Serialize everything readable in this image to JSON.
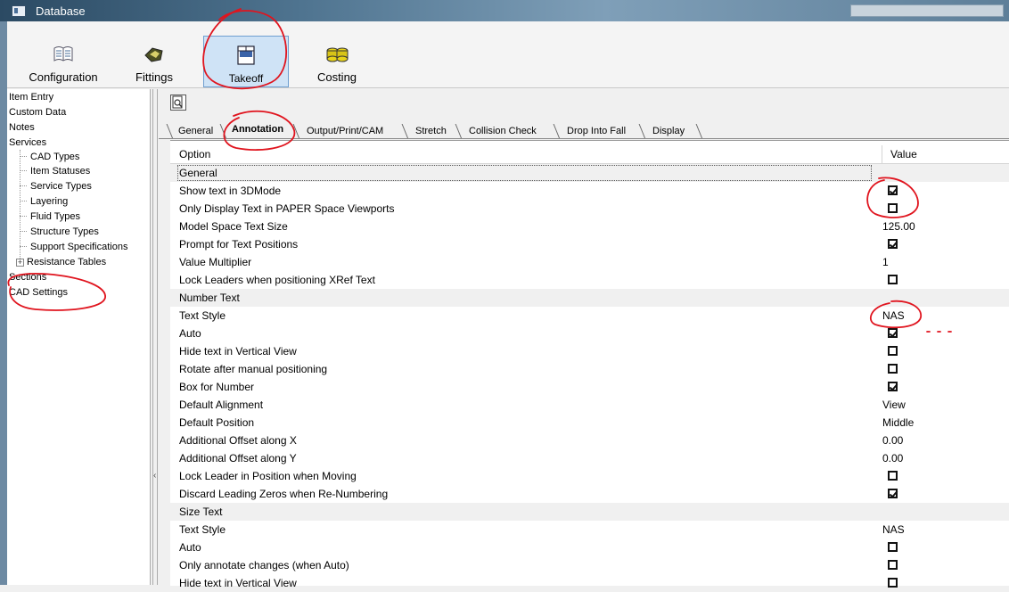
{
  "window": {
    "title": "Database"
  },
  "ribbon": {
    "buttons": [
      {
        "label": "Configuration"
      },
      {
        "label": "Fittings"
      },
      {
        "label": "Takeoff"
      },
      {
        "label": "Costing"
      }
    ]
  },
  "sidebar": {
    "items": [
      {
        "label": "Item Entry"
      },
      {
        "label": "Custom Data"
      },
      {
        "label": "Notes"
      },
      {
        "label": "Services"
      },
      {
        "label": "CAD Types"
      },
      {
        "label": "Item Statuses"
      },
      {
        "label": "Service Types"
      },
      {
        "label": "Layering"
      },
      {
        "label": "Fluid Types"
      },
      {
        "label": "Structure Types"
      },
      {
        "label": "Support Specifications"
      },
      {
        "label": "Resistance Tables"
      },
      {
        "label": "Sections"
      },
      {
        "label": "CAD Settings"
      }
    ]
  },
  "tabs": [
    {
      "label": "General"
    },
    {
      "label": "Annotation"
    },
    {
      "label": "Output/Print/CAM"
    },
    {
      "label": "Stretch"
    },
    {
      "label": "Collision Check"
    },
    {
      "label": "Drop Into Fall"
    },
    {
      "label": "Display"
    }
  ],
  "grid": {
    "header": {
      "option": "Option",
      "value": "Value"
    },
    "rows": [
      {
        "option": "General",
        "value": ""
      },
      {
        "option": "Show text in 3DMode",
        "value": "checked"
      },
      {
        "option": "Only Display Text in PAPER Space Viewports",
        "value": "unchecked"
      },
      {
        "option": "Model Space Text Size",
        "value": "125.00"
      },
      {
        "option": "Prompt for Text Positions",
        "value": "checked"
      },
      {
        "option": "Value Multiplier",
        "value": "1"
      },
      {
        "option": "Lock Leaders when positioning XRef Text",
        "value": "unchecked"
      },
      {
        "option": "Number Text",
        "value": ""
      },
      {
        "option": "Text Style",
        "value": "NAS"
      },
      {
        "option": "Auto",
        "value": "checked"
      },
      {
        "option": "Hide text in Vertical View",
        "value": "unchecked"
      },
      {
        "option": "Rotate after manual positioning",
        "value": "unchecked"
      },
      {
        "option": "Box for Number",
        "value": "checked"
      },
      {
        "option": "Default Alignment",
        "value": "View"
      },
      {
        "option": "Default Position",
        "value": "Middle"
      },
      {
        "option": "Additional Offset along X",
        "value": "0.00"
      },
      {
        "option": "Additional Offset along Y",
        "value": "0.00"
      },
      {
        "option": "Lock Leader in Position when Moving",
        "value": "unchecked"
      },
      {
        "option": "Discard Leading Zeros when Re-Numbering",
        "value": "checked"
      },
      {
        "option": "Size Text",
        "value": ""
      },
      {
        "option": "Text Style",
        "value": "NAS"
      },
      {
        "option": "Auto",
        "value": "unchecked"
      },
      {
        "option": "Only annotate changes (when Auto)",
        "value": "unchecked"
      },
      {
        "option": "Hide text in Vertical View",
        "value": "unchecked"
      }
    ]
  },
  "colors": {
    "annotation": "#e0141e",
    "ribbon_active": "#cfe3f6"
  }
}
